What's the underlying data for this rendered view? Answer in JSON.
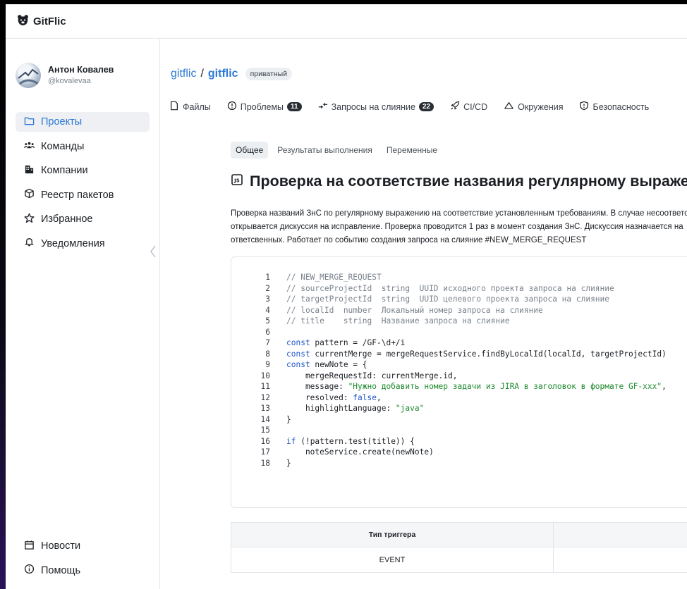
{
  "app": {
    "name": "GitFlic"
  },
  "user": {
    "name": "Антон Ковалев",
    "handle": "@kovalevaa"
  },
  "sidebar": {
    "items": [
      {
        "label": "Проекты",
        "icon": "folder-icon",
        "active": true
      },
      {
        "label": "Команды",
        "icon": "team-icon"
      },
      {
        "label": "Компании",
        "icon": "company-icon"
      },
      {
        "label": "Реестр пакетов",
        "icon": "package-icon"
      },
      {
        "label": "Избранное",
        "icon": "star-icon"
      },
      {
        "label": "Уведомления",
        "icon": "bell-icon"
      }
    ],
    "bottom": [
      {
        "label": "Новости",
        "icon": "news-icon"
      },
      {
        "label": "Помощь",
        "icon": "info-icon"
      }
    ]
  },
  "breadcrumb": {
    "owner": "gitflic",
    "project": "gitflic",
    "visibility": "приватный"
  },
  "tabs": [
    {
      "label": "Файлы",
      "icon": "file-icon"
    },
    {
      "label": "Проблемы",
      "icon": "issue-icon",
      "count": "11"
    },
    {
      "label": "Запросы на слияние",
      "icon": "merge-icon",
      "count": "22"
    },
    {
      "label": "CI/CD",
      "icon": "rocket-icon"
    },
    {
      "label": "Окружения",
      "icon": "cloud-icon"
    },
    {
      "label": "Безопасность",
      "icon": "shield-icon"
    }
  ],
  "subtabs": [
    {
      "label": "Общее",
      "active": true
    },
    {
      "label": "Результаты выполнения"
    },
    {
      "label": "Переменные"
    }
  ],
  "page": {
    "title": "Проверка на соответствие названия регулярному выражению",
    "description": [
      "Проверка названий ЗнС по регулярному выражению на соответствие установленным требованиям. В случае несоответствия",
      "открывается дискуссия на исправление. Проверка проводится 1 раз в момент создания ЗнС. Дискуссия назначается на",
      "ответсвенных. Работает по событию создания запроса на слияние #NEW_MERGE_REQUEST"
    ]
  },
  "code": {
    "language": "javascript",
    "lines": [
      "// NEW_MERGE_REQUEST",
      "// sourceProjectId  string  UUID исходного проекта запроса на слияние",
      "// targetProjectId  string  UUID целевого проекта запроса на слияние",
      "// localId  number  Локальный номер запроса на слияние",
      "// title    string  Название запроса на слияние",
      "",
      "const pattern = /GF-\\d+/i",
      "const currentMerge = mergeRequestService.findByLocalId(localId, targetProjectId)",
      "const newNote = {",
      "    mergeRequestId: currentMerge.id,",
      "    message: \"Нужно добавить номер задачи из JIRA в заголовок в формате GF-xxx\",",
      "    resolved: false,",
      "    highlightLanguage: \"java\"",
      "}",
      "",
      "if (!pattern.test(title)) {",
      "    noteService.create(newNote)",
      "}"
    ]
  },
  "trigger_table": {
    "headers": [
      "Тип триггера",
      ""
    ],
    "rows": [
      [
        "EVENT",
        ""
      ]
    ]
  },
  "colors": {
    "accent": "#2d79d6",
    "text": "#1b1f24",
    "badge": "#2a2f36"
  }
}
